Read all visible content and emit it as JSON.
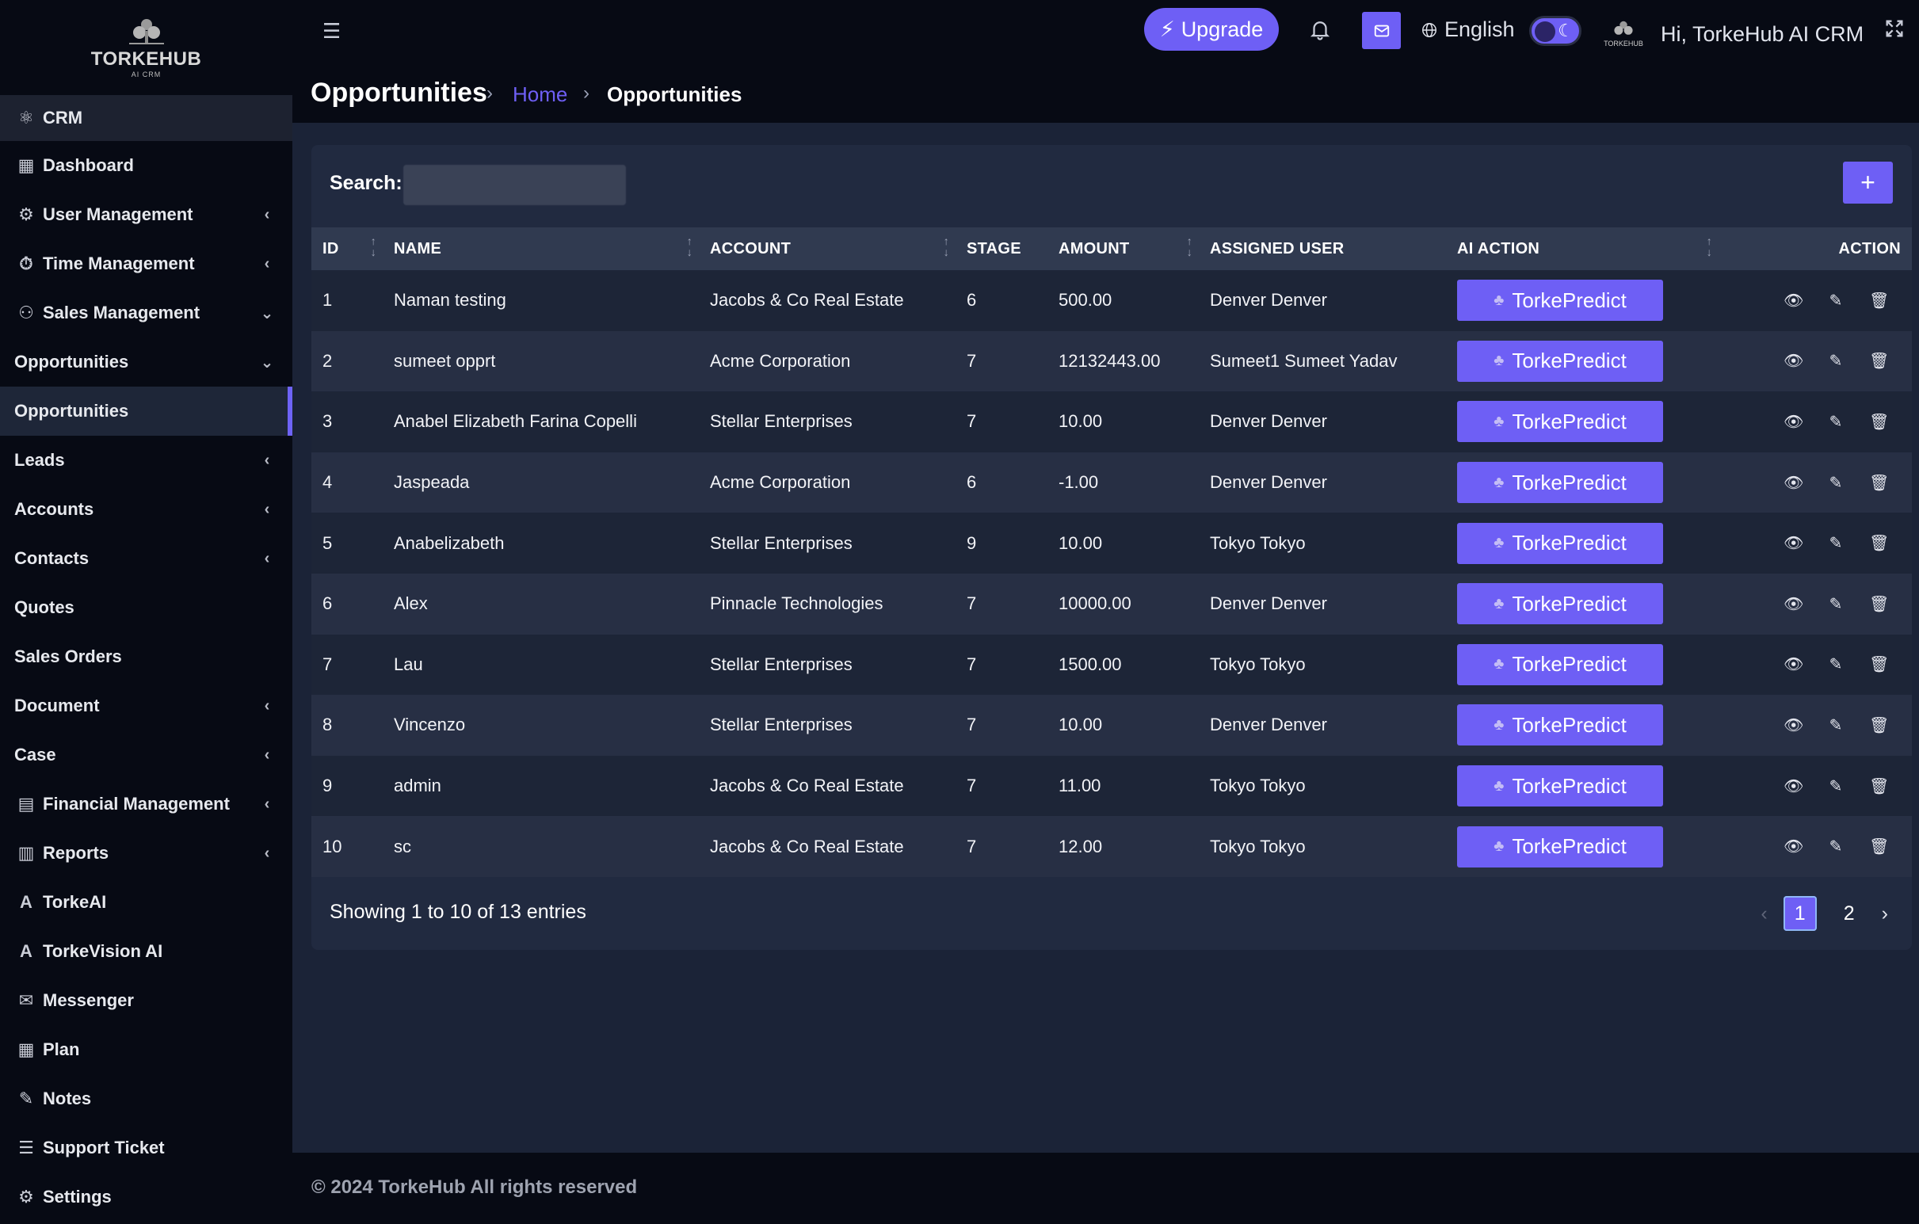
{
  "brand": {
    "name": "TORKEHUB",
    "sub": "AI CRM"
  },
  "sidebar": {
    "items": [
      {
        "label": "CRM",
        "icon": "crm-icon",
        "caret": "",
        "kind": "header"
      },
      {
        "label": "Dashboard",
        "icon": "dashboard-icon",
        "caret": ""
      },
      {
        "label": "User Management",
        "icon": "user-management-icon",
        "caret": "‹"
      },
      {
        "label": "Time Management",
        "icon": "time-management-icon",
        "caret": "‹"
      },
      {
        "label": "Sales Management",
        "icon": "sales-management-icon",
        "caret": "⌄"
      },
      {
        "label": "Opportunities",
        "icon": "",
        "caret": "⌄"
      },
      {
        "label": "Opportunities",
        "icon": "",
        "caret": "",
        "kind": "active"
      },
      {
        "label": "Leads",
        "icon": "",
        "caret": "‹"
      },
      {
        "label": "Accounts",
        "icon": "",
        "caret": "‹"
      },
      {
        "label": "Contacts",
        "icon": "",
        "caret": "‹"
      },
      {
        "label": "Quotes",
        "icon": "",
        "caret": ""
      },
      {
        "label": "Sales Orders",
        "icon": "",
        "caret": ""
      },
      {
        "label": "Document",
        "icon": "",
        "caret": "‹"
      },
      {
        "label": "Case",
        "icon": "",
        "caret": "‹"
      },
      {
        "label": "Financial Management",
        "icon": "financial-icon",
        "caret": "‹"
      },
      {
        "label": "Reports",
        "icon": "reports-icon",
        "caret": "‹"
      },
      {
        "label": "TorkeAI",
        "icon": "ai-icon",
        "caret": ""
      },
      {
        "label": "TorkeVision AI",
        "icon": "ai-icon",
        "caret": ""
      },
      {
        "label": "Messenger",
        "icon": "messenger-icon",
        "caret": ""
      },
      {
        "label": "Plan",
        "icon": "plan-icon",
        "caret": ""
      },
      {
        "label": "Notes",
        "icon": "notes-icon",
        "caret": ""
      },
      {
        "label": "Support Ticket",
        "icon": "support-icon",
        "caret": ""
      },
      {
        "label": "Settings",
        "icon": "settings-icon",
        "caret": ""
      }
    ]
  },
  "topbar": {
    "upgrade_label": "Upgrade",
    "language": "English",
    "greeting": "Hi, TorkeHub AI CRM"
  },
  "page": {
    "title": "Opportunities",
    "breadcrumb_home": "Home",
    "breadcrumb_current": "Opportunities"
  },
  "search": {
    "label": "Search:",
    "value": ""
  },
  "table": {
    "columns": [
      "ID",
      "NAME",
      "ACCOUNT",
      "STAGE",
      "AMOUNT",
      "ASSIGNED USER",
      "AI ACTION",
      "ACTION"
    ],
    "ai_button_label": "TorkePredict",
    "rows": [
      {
        "id": "1",
        "name": "Naman testing",
        "account": "Jacobs & Co Real Estate",
        "stage": "6",
        "amount": "500.00",
        "user": "Denver Denver"
      },
      {
        "id": "2",
        "name": "sumeet opprt",
        "account": "Acme Corporation",
        "stage": "7",
        "amount": "12132443.00",
        "user": "Sumeet1 Sumeet Yadav"
      },
      {
        "id": "3",
        "name": "Anabel Elizabeth Farina Copelli",
        "account": "Stellar Enterprises",
        "stage": "7",
        "amount": "10.00",
        "user": "Denver Denver"
      },
      {
        "id": "4",
        "name": "Jaspeada",
        "account": "Acme Corporation",
        "stage": "6",
        "amount": "-1.00",
        "user": "Denver Denver"
      },
      {
        "id": "5",
        "name": "Anabelizabeth",
        "account": "Stellar Enterprises",
        "stage": "9",
        "amount": "10.00",
        "user": "Tokyo Tokyo"
      },
      {
        "id": "6",
        "name": "Alex",
        "account": "Pinnacle Technologies",
        "stage": "7",
        "amount": "10000.00",
        "user": "Denver Denver"
      },
      {
        "id": "7",
        "name": "Lau",
        "account": "Stellar Enterprises",
        "stage": "7",
        "amount": "1500.00",
        "user": "Tokyo Tokyo"
      },
      {
        "id": "8",
        "name": "Vincenzo",
        "account": "Stellar Enterprises",
        "stage": "7",
        "amount": "10.00",
        "user": "Denver Denver"
      },
      {
        "id": "9",
        "name": "admin",
        "account": "Jacobs & Co Real Estate",
        "stage": "7",
        "amount": "11.00",
        "user": "Tokyo Tokyo"
      },
      {
        "id": "10",
        "name": "sc",
        "account": "Jacobs & Co Real Estate",
        "stage": "7",
        "amount": "12.00",
        "user": "Tokyo Tokyo"
      }
    ]
  },
  "pagination": {
    "summary": "Showing 1 to 10 of 13 entries",
    "pages": [
      "1",
      "2"
    ],
    "current": "1"
  },
  "footer": {
    "text": "© 2024 TorkeHub All rights reserved"
  },
  "colors": {
    "accent": "#6e5ff5",
    "sidebar_bg": "#070a14",
    "content_bg": "#1b2337",
    "card_bg": "#212a40"
  }
}
